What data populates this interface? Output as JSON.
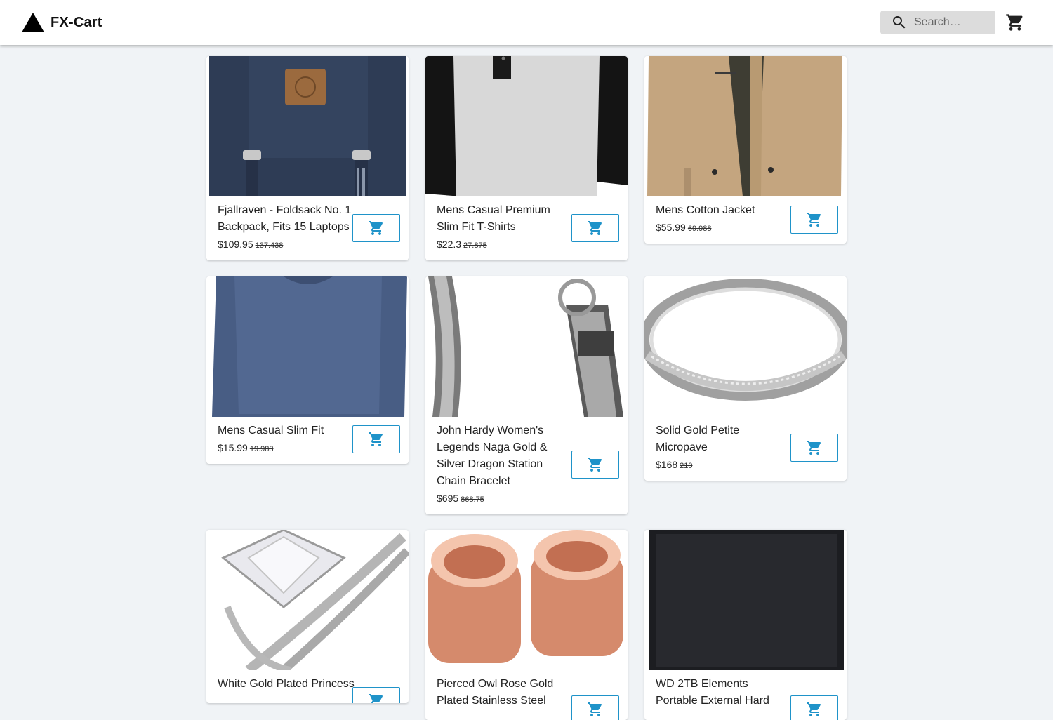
{
  "header": {
    "title": "FX-Cart",
    "search_placeholder": "Search…",
    "icons": {
      "logo": "triangle-logo",
      "search": "search-icon",
      "cart": "cart-icon"
    }
  },
  "colors": {
    "accent": "#1f93c9",
    "background": "#f0f3f6",
    "search_bg": "#dcdcdc"
  },
  "products": [
    {
      "title": "Fjallraven - Foldsack No. 1 Backpack, Fits 15 Laptops",
      "price": "$109.95",
      "old_price": "137.438",
      "image": "navy-backpack"
    },
    {
      "title": "Mens Casual Premium Slim Fit T-Shirts",
      "price": "$22.3",
      "old_price": "27.875",
      "image": "raglan-tshirt"
    },
    {
      "title": "Mens Cotton Jacket",
      "price": "$55.99",
      "old_price": "69.988",
      "image": "khaki-jacket"
    },
    {
      "title": "Mens Casual Slim Fit",
      "price": "$15.99",
      "old_price": "19.988",
      "image": "blue-longsleeve"
    },
    {
      "title": "John Hardy Women's Legends Naga Gold & Silver Dragon Station Chain Bracelet",
      "price": "$695",
      "old_price": "868.75",
      "image": "dragon-bracelet"
    },
    {
      "title": "Solid Gold Petite Micropave",
      "price": "$168",
      "old_price": "210",
      "image": "silver-bangle"
    },
    {
      "title": "White Gold Plated Princess",
      "price": "",
      "old_price": "",
      "image": "diamond-ring"
    },
    {
      "title": "Pierced Owl Rose Gold Plated Stainless Steel",
      "price": "",
      "old_price": "",
      "image": "rose-gold-plugs"
    },
    {
      "title": "WD 2TB Elements Portable External Hard",
      "price": "",
      "old_price": "",
      "image": "black-hard-drive"
    }
  ]
}
